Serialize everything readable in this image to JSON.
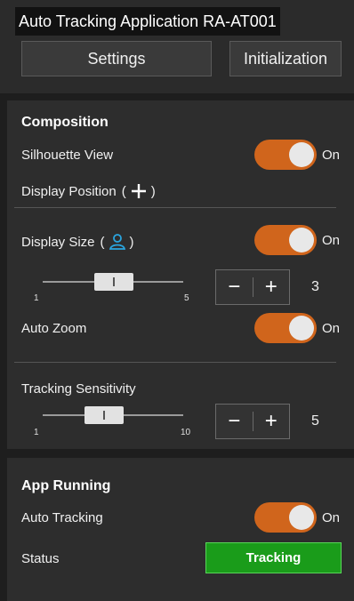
{
  "header": {
    "title": "Auto Tracking Application RA-AT001",
    "settings_label": "Settings",
    "init_label": "Initialization"
  },
  "composition": {
    "heading": "Composition",
    "silhouette_view": {
      "label": "Silhouette View",
      "state": "On",
      "on": true
    },
    "display_position": {
      "label": "Display Position",
      "icon": "crosshair-plus-icon"
    },
    "display_size": {
      "label": "Display Size",
      "icon": "person-icon",
      "state": "On",
      "on": true,
      "slider": {
        "min": "1",
        "max": "5",
        "value": 3
      },
      "value": "3"
    },
    "auto_zoom": {
      "label": "Auto Zoom",
      "state": "On",
      "on": true
    },
    "tracking_sensitivity": {
      "label": "Tracking Sensitivity",
      "slider": {
        "min": "1",
        "max": "10",
        "value": 5
      },
      "value": "5"
    }
  },
  "app_running": {
    "heading": "App Running",
    "auto_tracking": {
      "label": "Auto Tracking",
      "state": "On",
      "on": true
    },
    "status": {
      "label": "Status",
      "value": "Tracking"
    }
  },
  "colors": {
    "toggle_on": "#d0651c",
    "status_green": "#1a9c1a",
    "accent_icon": "#2aa6e0"
  },
  "stepper": {
    "minus": "−",
    "plus": "+"
  }
}
